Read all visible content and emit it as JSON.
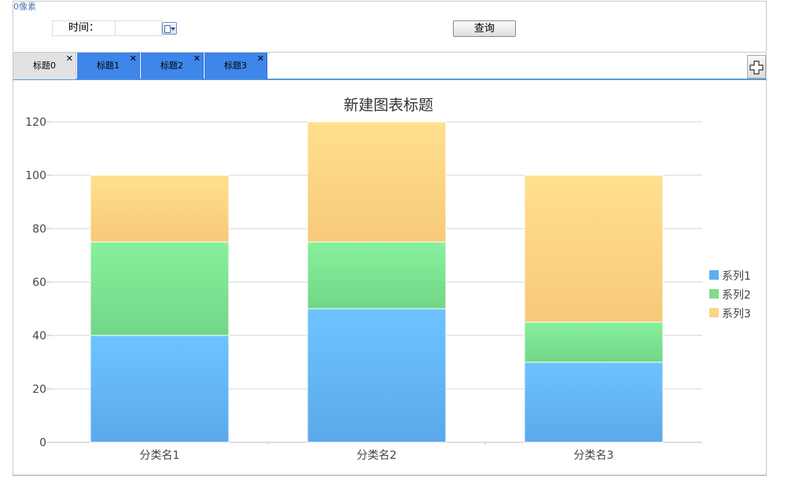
{
  "page": {
    "pixel_label": "0像素"
  },
  "toolbar": {
    "time_label": "时间：",
    "time_value": "",
    "query_label": "查询"
  },
  "tabs": [
    {
      "label": "标题0",
      "active": false
    },
    {
      "label": "标题1",
      "active": true
    },
    {
      "label": "标题2",
      "active": true
    },
    {
      "label": "标题3",
      "active": true
    }
  ],
  "icons": {
    "tab_close": "close-icon",
    "add_tab": "plus-outline-icon",
    "date_picker": "calendar-dropdown-icon"
  },
  "chart_data": {
    "type": "bar",
    "stacked": true,
    "title": "新建图表标题",
    "categories": [
      "分类名1",
      "分类名2",
      "分类名3"
    ],
    "series": [
      {
        "name": "系列1",
        "values": [
          40,
          50,
          30
        ],
        "color": "#5eaef2"
      },
      {
        "name": "系列2",
        "values": [
          35,
          25,
          15
        ],
        "color": "#7edc8c"
      },
      {
        "name": "系列3",
        "values": [
          25,
          45,
          55
        ],
        "color": "#fbd484"
      }
    ],
    "ylim": [
      0,
      120
    ],
    "yticks": [
      0,
      20,
      40,
      60,
      80,
      100,
      120
    ],
    "grid": true,
    "legend": "right"
  }
}
